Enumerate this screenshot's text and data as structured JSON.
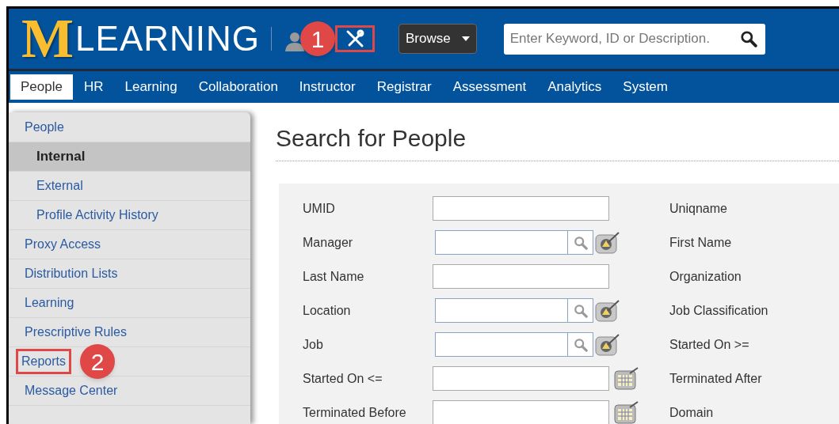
{
  "header": {
    "logo_letter": "M",
    "logo_text": "LEARNING",
    "tools": {
      "highlighted": true,
      "callout": "1"
    },
    "browse": "Browse",
    "search": {
      "placeholder": "Enter Keyword, ID or Description."
    }
  },
  "nav": [
    {
      "label": "People",
      "selected": true
    },
    {
      "label": "HR",
      "selected": false
    },
    {
      "label": "Learning",
      "selected": false
    },
    {
      "label": "Collaboration",
      "selected": false
    },
    {
      "label": "Instructor",
      "selected": false
    },
    {
      "label": "Registrar",
      "selected": false
    },
    {
      "label": "Assessment",
      "selected": false
    },
    {
      "label": "Analytics",
      "selected": false
    },
    {
      "label": "System",
      "selected": false
    }
  ],
  "sidebar": {
    "items": [
      {
        "label": "People",
        "selected": false,
        "highlighted": false,
        "children": [
          {
            "label": "Internal",
            "selected": true,
            "highlighted": false
          },
          {
            "label": "External",
            "selected": false,
            "highlighted": false
          },
          {
            "label": "Profile Activity History",
            "selected": false,
            "highlighted": false
          }
        ]
      },
      {
        "label": "Proxy Access",
        "selected": false,
        "highlighted": false
      },
      {
        "label": "Distribution Lists",
        "selected": false,
        "highlighted": false
      },
      {
        "label": "Learning",
        "selected": false,
        "highlighted": false
      },
      {
        "label": "Prescriptive Rules",
        "selected": false,
        "highlighted": false
      },
      {
        "label": "Reports",
        "selected": false,
        "highlighted": true,
        "callout": "2"
      },
      {
        "label": "Message Center",
        "selected": false,
        "highlighted": false
      }
    ]
  },
  "page_title": "Search for People",
  "form": {
    "rows": [
      {
        "label": "UMID",
        "kind": "text",
        "right_label": "Uniqname"
      },
      {
        "label": "Manager",
        "kind": "lookup",
        "right_label": "First Name"
      },
      {
        "label": "Last Name",
        "kind": "text",
        "right_label": "Organization"
      },
      {
        "label": "Location",
        "kind": "lookup",
        "right_label": "Job Classification"
      },
      {
        "label": "Job",
        "kind": "lookup",
        "right_label": "Started On >="
      },
      {
        "label": "Started On <=",
        "kind": "date",
        "right_label": "Terminated After"
      },
      {
        "label": "Terminated Before",
        "kind": "date",
        "right_label": "Domain"
      }
    ]
  }
}
